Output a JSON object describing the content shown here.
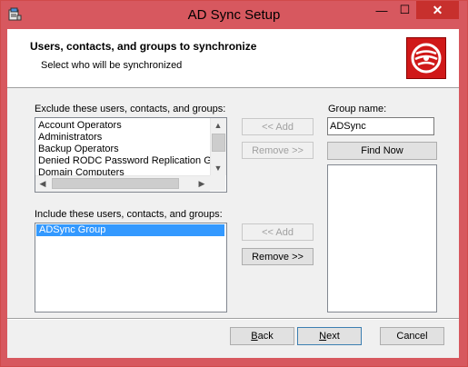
{
  "window": {
    "title": "AD Sync Setup",
    "minimize_glyph": "—",
    "maximize_glyph": "☐",
    "close_glyph": "✕",
    "colors": {
      "titlebar": "#d7585f",
      "close": "#c7302d",
      "selection": "#3399ff",
      "logo": "#d01818"
    }
  },
  "header": {
    "title": "Users, contacts, and groups to synchronize",
    "subtitle": "Select who will be synchronized",
    "logo_icon": "disc-icon"
  },
  "exclude": {
    "label": "Exclude these users, contacts, and groups:",
    "items": [
      "Account Operators",
      "Administrators",
      "Backup Operators",
      "Denied RODC Password Replication Gro",
      "Domain Computers"
    ]
  },
  "include": {
    "label": "Include these users, contacts, and groups:",
    "items": [
      "ADSync Group"
    ],
    "selected_index": 0
  },
  "buttons": {
    "add_top": "<< Add",
    "remove_top": "Remove >>",
    "add_bottom": "<< Add",
    "remove_bottom": "Remove >>",
    "find_now": "Find Now",
    "back_accel": "B",
    "back_rest": "ack",
    "next_accel": "N",
    "next_rest": "ext",
    "cancel": "Cancel"
  },
  "group": {
    "label": "Group name:",
    "value": "ADSync"
  }
}
